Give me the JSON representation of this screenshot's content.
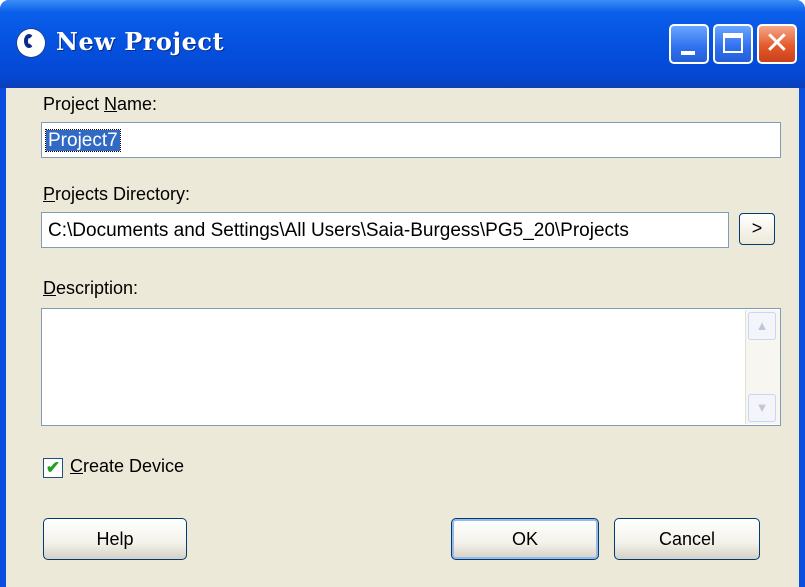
{
  "window": {
    "title": "New Project"
  },
  "project_name": {
    "label_pre": "Project ",
    "label_key": "N",
    "label_post": "ame:",
    "value": "Project7"
  },
  "projects_directory": {
    "label_pre": "",
    "label_key": "P",
    "label_post": "rojects Directory:",
    "value": "C:\\Documents and Settings\\All Users\\Saia-Burgess\\PG5_20\\Projects",
    "browse_label": ">"
  },
  "description": {
    "label_pre": "",
    "label_key": "D",
    "label_post": "escription:",
    "value": ""
  },
  "create_device": {
    "label_pre": "",
    "label_key": "C",
    "label_post": "reate Device",
    "checked": true,
    "mark": "✔"
  },
  "buttons": {
    "help": "Help",
    "ok": "OK",
    "cancel": "Cancel"
  },
  "colors": {
    "titlebar": "#0551e0",
    "client": "#ece9d8",
    "selection": "#316ac5",
    "close": "#e55a2c"
  },
  "icons": [
    "app-logo-icon",
    "minimize-icon",
    "maximize-icon",
    "close-icon",
    "scroll-up-arrow-icon",
    "scroll-down-arrow-icon",
    "checkmark-icon"
  ]
}
